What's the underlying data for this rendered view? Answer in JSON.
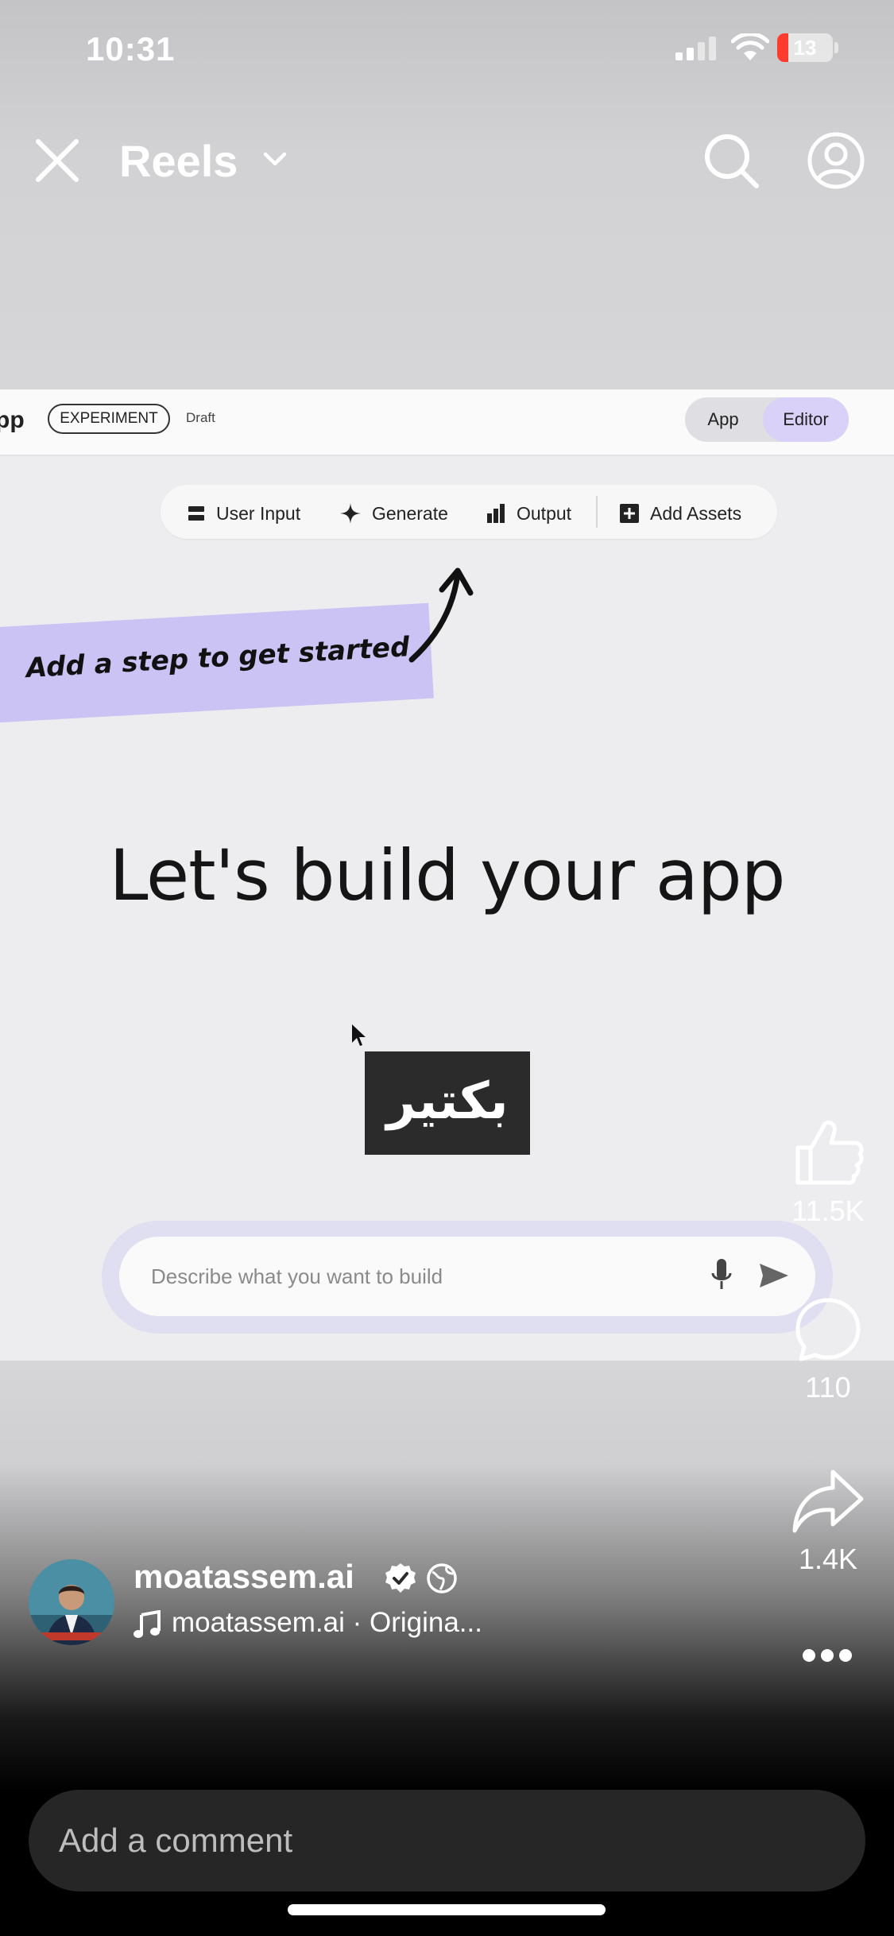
{
  "status_bar": {
    "time": "10:31",
    "battery_level": "13",
    "icons": [
      "cellular-signal-icon",
      "wifi-icon",
      "battery-icon"
    ]
  },
  "nav": {
    "title": "Reels",
    "icons": [
      "close-icon",
      "chevron-down-icon",
      "search-icon",
      "profile-icon"
    ]
  },
  "video": {
    "app_name": "pp",
    "badge": "EXPERIMENT",
    "draft": "Draft",
    "toggle": {
      "app": "App",
      "editor": "Editor"
    },
    "toolbar": [
      {
        "label": "User Input",
        "icon": "user-input-icon"
      },
      {
        "label": "Generate",
        "icon": "sparkle-icon"
      },
      {
        "label": "Output",
        "icon": "output-chart-icon"
      },
      {
        "label": "Add Assets",
        "icon": "add-assets-icon"
      }
    ],
    "sticky_note": "Add a step to get started",
    "headline": "Let's build your app",
    "caption": "بكتير",
    "prompt_placeholder": "Describe what you want to build"
  },
  "actions": {
    "likes": "11.5K",
    "comments": "110",
    "shares": "1.4K"
  },
  "creator": {
    "username": "moatassem.ai",
    "audio": "moatassem.ai · Origina..."
  },
  "comment": {
    "placeholder": "Add a comment"
  },
  "colors": {
    "accent_purple": "#cbc3f3",
    "editor_toggle": "#d9d1f7",
    "battery_low": "#ff3b30"
  }
}
